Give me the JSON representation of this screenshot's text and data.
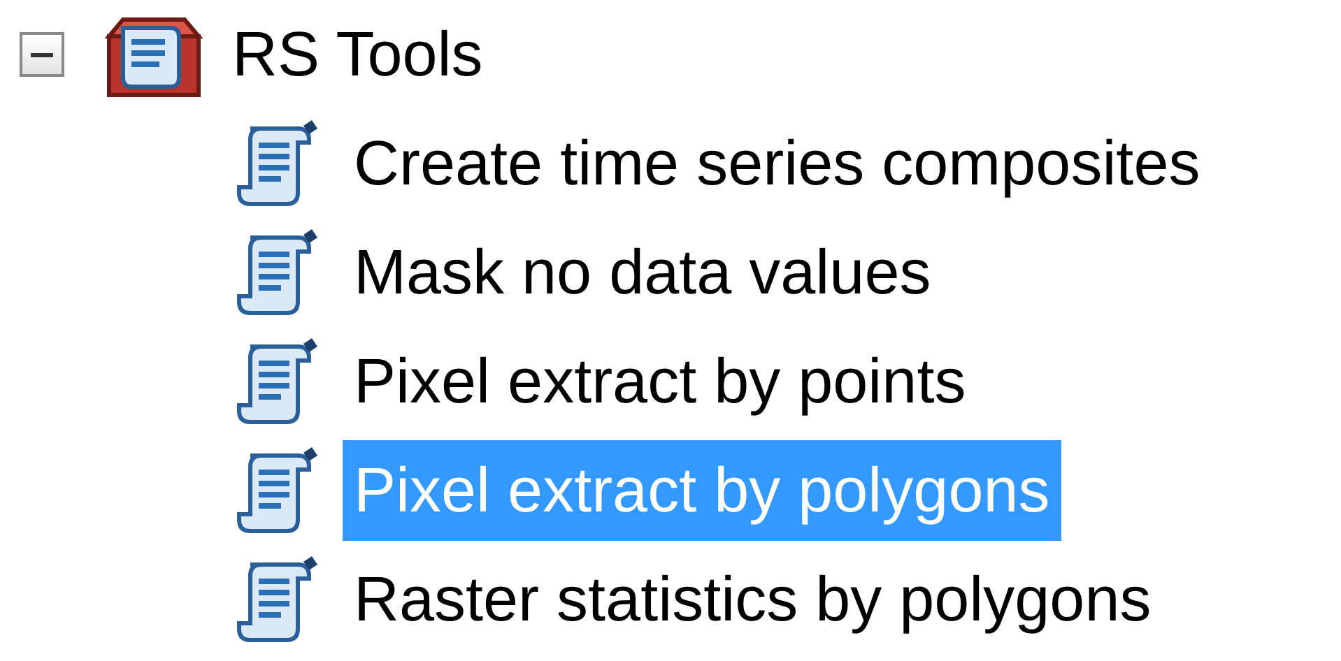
{
  "toolbox": {
    "label": "RS Tools",
    "expanded": true,
    "children": [
      {
        "label": "Create time series composites",
        "selected": false
      },
      {
        "label": "Mask no data values",
        "selected": false
      },
      {
        "label": "Pixel extract by points",
        "selected": false
      },
      {
        "label": "Pixel extract by polygons",
        "selected": true
      },
      {
        "label": "Raster statistics by polygons",
        "selected": false
      }
    ]
  }
}
